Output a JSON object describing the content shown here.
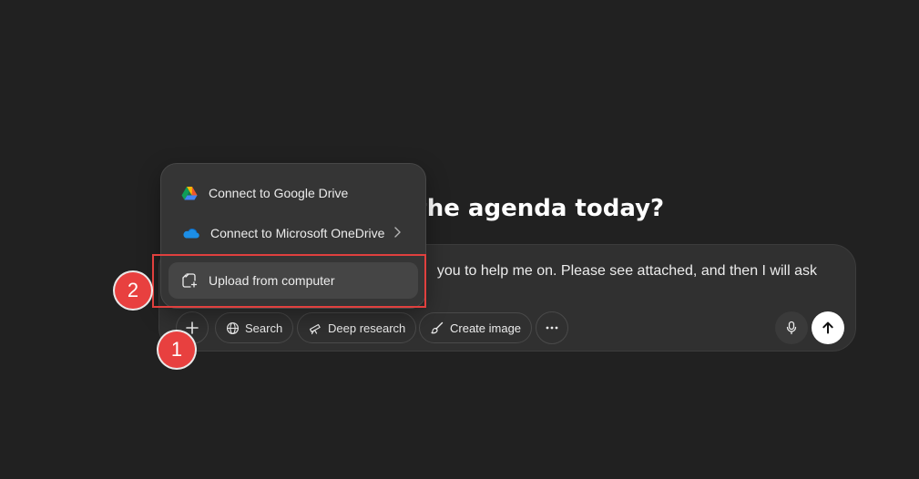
{
  "heading": {
    "visible_text": "on the agenda today?"
  },
  "composer": {
    "prompt_line1": "you to help me on. Please see attached, and then I will ask",
    "buttons": {
      "search_label": "Search",
      "deep_research_label": "Deep research",
      "create_image_label": "Create image"
    }
  },
  "attach_menu": {
    "items": [
      {
        "label": "Connect to Google Drive",
        "icon": "google-drive-icon"
      },
      {
        "label": "Connect to Microsoft OneDrive",
        "icon": "onedrive-icon",
        "has_submenu": true
      },
      {
        "label": "Upload from computer",
        "icon": "upload-file-icon",
        "highlighted": true
      }
    ]
  },
  "annotations": {
    "badge_1": "1",
    "badge_2": "2",
    "highlight_color": "#e0403e"
  },
  "colors": {
    "background": "#212121",
    "composer": "#303030",
    "menu": "#353535",
    "send_button": "#ffffff"
  }
}
